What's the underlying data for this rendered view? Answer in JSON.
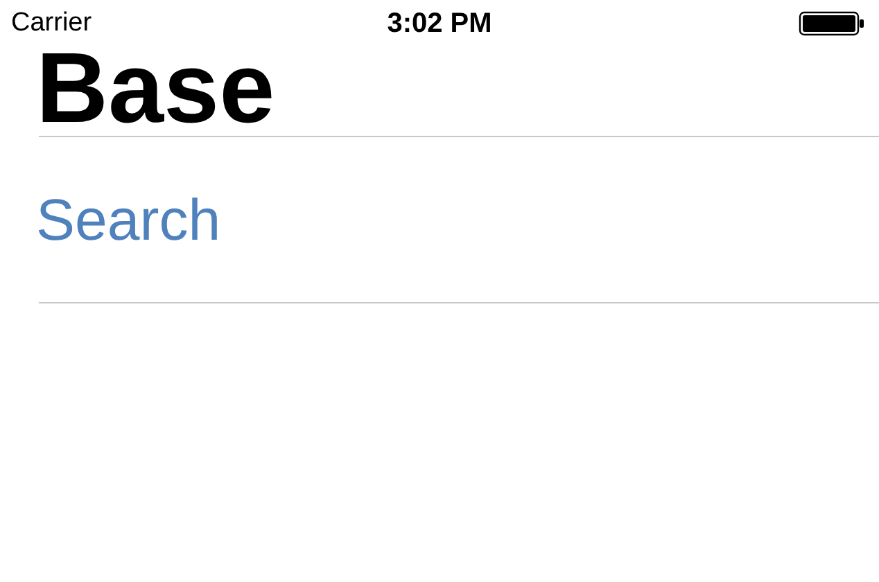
{
  "status_bar": {
    "carrier": "Carrier",
    "time": "3:02 PM"
  },
  "title": "Base",
  "search": {
    "placeholder": "Search"
  }
}
